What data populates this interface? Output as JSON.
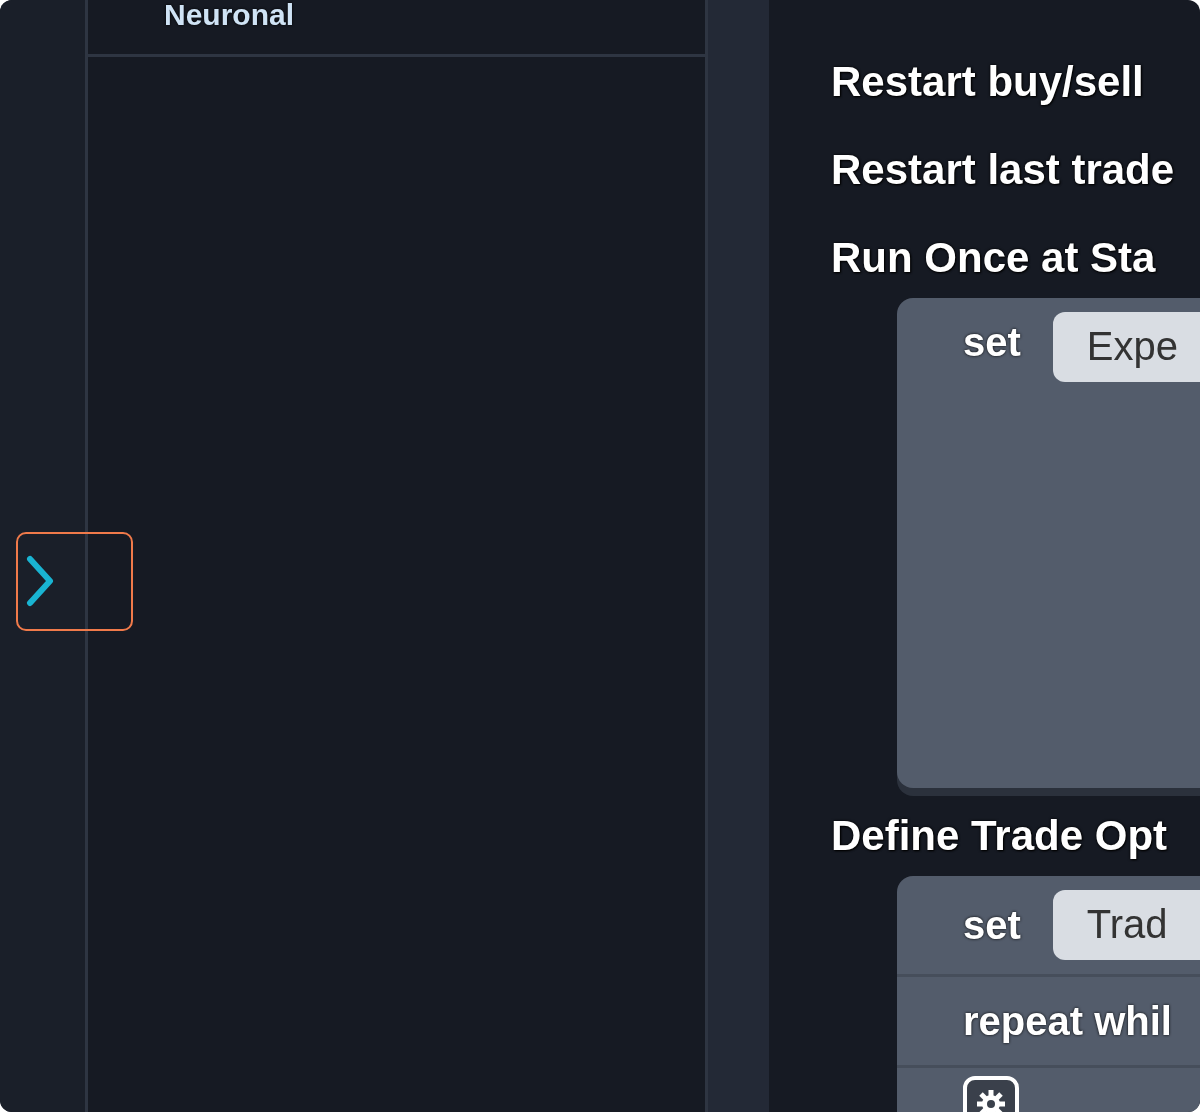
{
  "sidebar": {
    "category": "Neuronal",
    "collapse_toggle": {
      "highlighted": true
    }
  },
  "workspace": {
    "items": [
      {
        "kind": "label",
        "text": "Restart buy/sell"
      },
      {
        "kind": "label",
        "text": "Restart last trade"
      },
      {
        "kind": "label",
        "text": "Run Once at Sta"
      },
      {
        "kind": "block",
        "rows": [
          {
            "kind": "set",
            "keyword": "set",
            "field": "Expe"
          }
        ]
      },
      {
        "kind": "label",
        "text": "Define Trade Opt"
      },
      {
        "kind": "block",
        "rows": [
          {
            "kind": "set",
            "keyword": "set",
            "field": "Trad"
          },
          {
            "kind": "repeat",
            "keyword": "repeat whil"
          },
          {
            "kind": "gear"
          }
        ]
      }
    ]
  }
}
